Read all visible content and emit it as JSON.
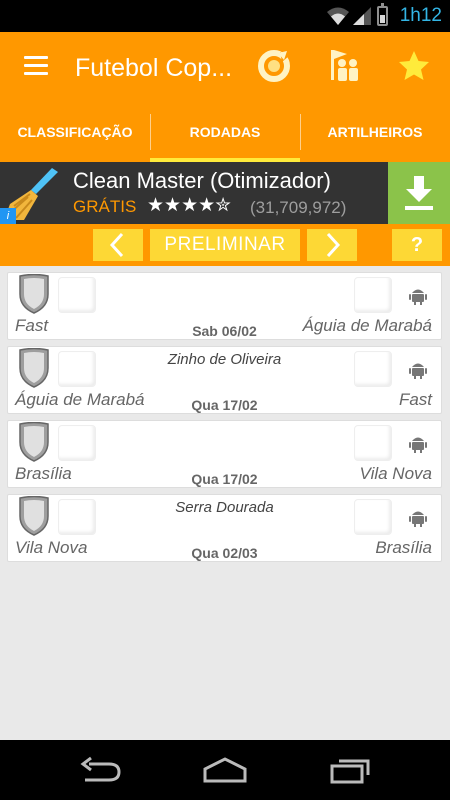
{
  "status": {
    "time": "1h12"
  },
  "app": {
    "title": "Futebol Cop...",
    "icons": [
      "menu-icon",
      "refresh-icon",
      "team-icon",
      "favorite-star-icon"
    ]
  },
  "tabs": [
    {
      "label": "CLASSIFICAÇÃO",
      "active": false
    },
    {
      "label": "RODADAS",
      "active": true
    },
    {
      "label": "ARTILHEIROS",
      "active": false
    }
  ],
  "ad": {
    "title": "Clean Master (Otimizador)",
    "price": "GRÁTIS",
    "stars": "★★★★✮",
    "rating_count": "(31,709,972)",
    "info_label": "i"
  },
  "round": {
    "label": "PRELIMINAR",
    "prev_icon": "chevron-left-icon",
    "next_icon": "chevron-right-icon",
    "help_label": "?"
  },
  "matches": [
    {
      "home": "Fast",
      "away": "Águia de Marabá",
      "date": "Sab 06/02",
      "venue": ""
    },
    {
      "home": "Águia de Marabá",
      "away": "Fast",
      "date": "Qua 17/02",
      "venue": "Zinho de Oliveira"
    },
    {
      "home": "Brasília",
      "away": "Vila Nova",
      "date": "Qua 17/02",
      "venue": ""
    },
    {
      "home": "Vila Nova",
      "away": "Brasília",
      "date": "Qua 02/03",
      "venue": "Serra Dourada"
    }
  ],
  "colors": {
    "primary": "#ff9800",
    "accent": "#fdd835",
    "tab_indicator": "#ffeb3b",
    "clock": "#33b5e5",
    "ad_download": "#8bc34a"
  }
}
